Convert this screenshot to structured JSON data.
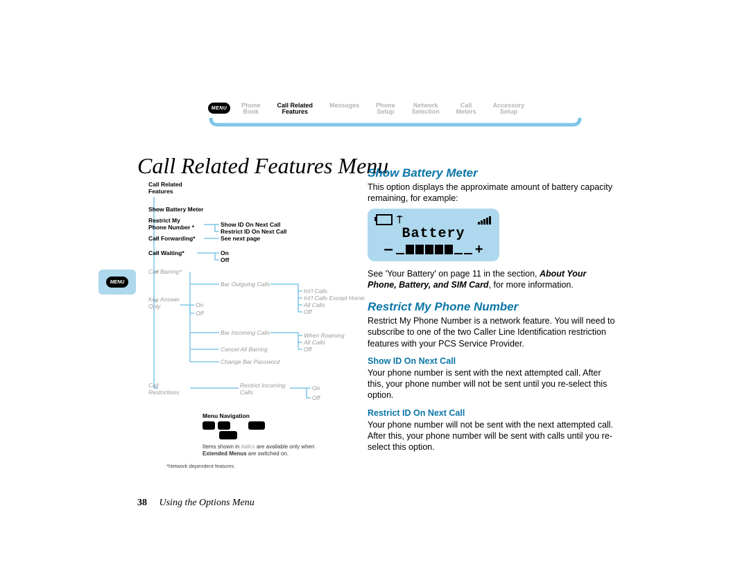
{
  "nav": {
    "menu_badge": "MENU",
    "items": [
      {
        "line1": "Phone",
        "line2": "Book"
      },
      {
        "line1": "Call Related",
        "line2": "Features"
      },
      {
        "line1": "Messages",
        "line2": ""
      },
      {
        "line1": "Phone",
        "line2": "Setup"
      },
      {
        "line1": "Network",
        "line2": "Selection"
      },
      {
        "line1": "Call",
        "line2": "Meters"
      },
      {
        "line1": "Accessory",
        "line2": "Setup"
      }
    ],
    "active_index": 1
  },
  "title": "Call Related Features Menu",
  "margin_badge": "MENU",
  "tree": {
    "root1": "Call Related",
    "root2": "Features",
    "i1": "Show Battery Meter",
    "i2a": "Restrict My",
    "i2b": "Phone Number *",
    "i2c1": "Show ID On Next Call",
    "i2c2": "Restrict ID On Next Call",
    "i3": "Call Forwarding*",
    "i3c": "See next page",
    "i4": "Call Waiting*",
    "i4c1": "On",
    "i4c2": "Off",
    "i5": "Call Barring*",
    "i5c1": "Bar Outgoing Calls",
    "i5c1a": "Int'l Calls",
    "i5c1b": "Int'l Calls Except Home",
    "i5c1c": "All Calls",
    "i5c1d": "Off",
    "i5c2": "Bar Incoming Calls",
    "i5c2a": "When Roaming",
    "i5c2b": "All Calls",
    "i5c2c": "Off",
    "i5c3": "Cancel All Barring",
    "i5c4": "Change Bar Password",
    "i6a": "Key Answer",
    "i6b": "Only",
    "i6c1": "On",
    "i6c2": "Off",
    "i7a": "Call",
    "i7b": "Restrictions",
    "i7c1": "Restrict Incoming",
    "i7c1b": "Calls",
    "i7c1c1": "On",
    "i7c1c2": "Off",
    "legend_title": "Menu Navigation",
    "legend_note_pre": "Items shown in ",
    "legend_note_ital": "italics",
    "legend_note_post": " are available only when ",
    "legend_note_bold": "Extended Menus",
    "legend_note_end": " are switched on.",
    "foot": "*Network dependent features."
  },
  "content": {
    "s1_title": "Show Battery Meter",
    "s1_p": "This option displays the approximate amount of battery capacity remaining, for example:",
    "batt_label": "Battery",
    "s1_p2_pre": "See 'Your Battery' on page 11 in the section, ",
    "s1_p2_bi": "About Your Phone, Battery, and SIM Card",
    "s1_p2_post": ", for more information.",
    "s2_title": "Restrict My Phone Number",
    "s2_p": "Restrict My Phone Number is a network feature. You will need to subscribe to one of the two Caller Line Identification restriction features with your PCS Service Provider.",
    "s2_sub1": "Show ID On Next Call",
    "s2_sub1_p": "Your phone number is sent with the next attempted call. After this, your phone number will not be sent until you re-select this option.",
    "s2_sub2": "Restrict ID On Next Call",
    "s2_sub2_p": "Your phone number will not be sent with the next attempted call. After this, your phone number will be sent with calls until you re-select this option."
  },
  "footer": {
    "page": "38",
    "caption": "Using the Options Menu"
  }
}
